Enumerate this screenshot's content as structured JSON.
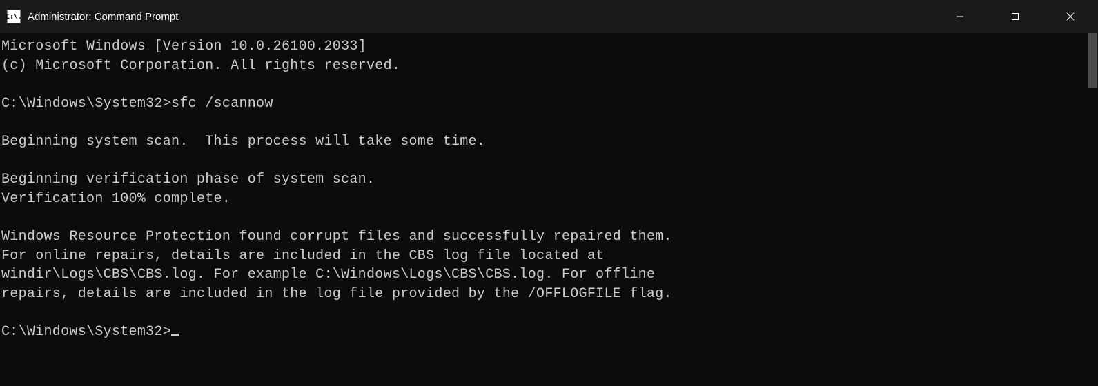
{
  "titlebar": {
    "icon_text": "C:\\.",
    "title": "Administrator: Command Prompt"
  },
  "terminal": {
    "lines": [
      "Microsoft Windows [Version 10.0.26100.2033]",
      "(c) Microsoft Corporation. All rights reserved.",
      "",
      "C:\\Windows\\System32>sfc /scannow",
      "",
      "Beginning system scan.  This process will take some time.",
      "",
      "Beginning verification phase of system scan.",
      "Verification 100% complete.",
      "",
      "Windows Resource Protection found corrupt files and successfully repaired them.",
      "For online repairs, details are included in the CBS log file located at",
      "windir\\Logs\\CBS\\CBS.log. For example C:\\Windows\\Logs\\CBS\\CBS.log. For offline",
      "repairs, details are included in the log file provided by the /OFFLOGFILE flag.",
      ""
    ],
    "prompt": "C:\\Windows\\System32>"
  }
}
